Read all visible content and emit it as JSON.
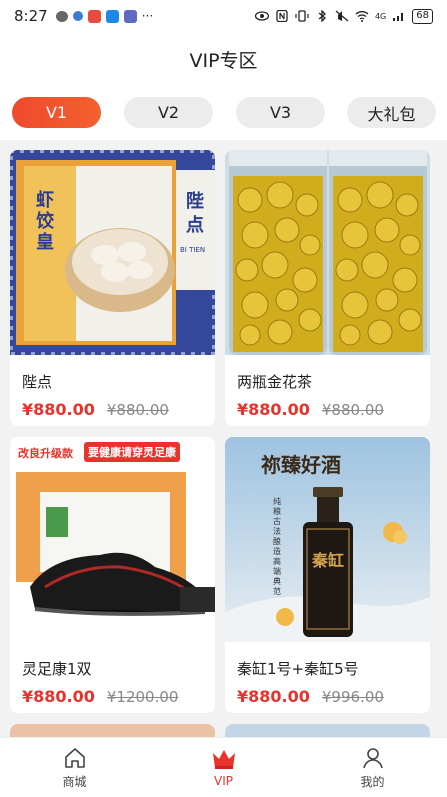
{
  "status_bar": {
    "time": "8:27",
    "dots": "···",
    "network": "4G",
    "battery": "68"
  },
  "header": {
    "title": "VIP专区"
  },
  "tabs": [
    {
      "label": "V1",
      "active": true
    },
    {
      "label": "V2",
      "active": false
    },
    {
      "label": "V3",
      "active": false
    },
    {
      "label": "大礼包",
      "active": false
    }
  ],
  "products": [
    {
      "title": "陛点",
      "price": "¥880.00",
      "old_price": "¥880.00",
      "image_text_1": "虾饺皇",
      "image_text_2": "陛点",
      "image_text_3": "BI TIEN"
    },
    {
      "title": "两瓶金花茶",
      "price": "¥880.00",
      "old_price": "¥880.00"
    },
    {
      "title": "灵足康1双",
      "price": "¥880.00",
      "old_price": "¥1200.00",
      "badge_1": "改良升级款",
      "badge_2": "要健康请穿灵足康"
    },
    {
      "title": "秦缸1号+秦缸5号",
      "price": "¥880.00",
      "old_price": "¥996.00",
      "image_text_1": "祢臻好酒",
      "image_text_2": "秦缸",
      "image_text_3": "纯粮古法酿造 高端典范"
    }
  ],
  "bottom_nav": [
    {
      "label": "商城",
      "icon": "home-icon",
      "active": false
    },
    {
      "label": "VIP",
      "icon": "crown-icon",
      "active": true
    },
    {
      "label": "我的",
      "icon": "user-icon",
      "active": false
    }
  ],
  "colors": {
    "accent": "#e8322b",
    "tab_active": "#f04a2c"
  }
}
